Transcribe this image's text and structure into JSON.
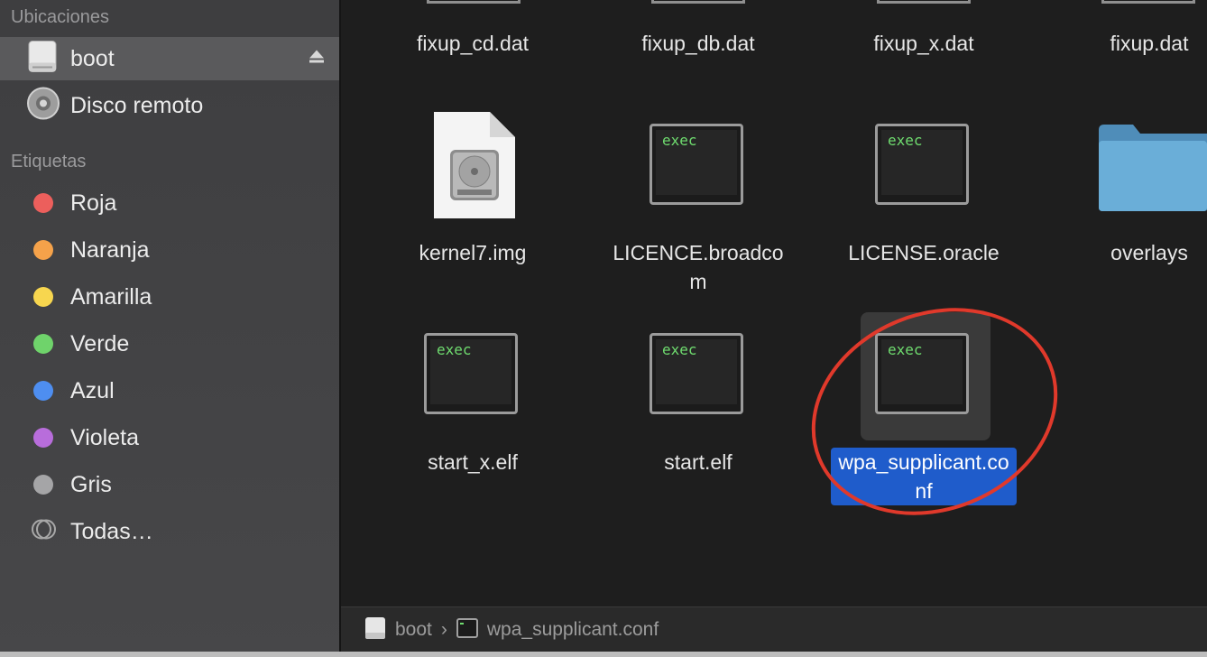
{
  "sidebar": {
    "locations_header": "Ubicaciones",
    "locations": [
      {
        "label": "boot",
        "icon": "drive-icon",
        "selected": true
      },
      {
        "label": "Disco remoto",
        "icon": "disc-icon",
        "selected": false
      }
    ],
    "tags_header": "Etiquetas",
    "tags": [
      {
        "label": "Roja",
        "color": "#ec5f5c"
      },
      {
        "label": "Naranja",
        "color": "#f5a24a"
      },
      {
        "label": "Amarilla",
        "color": "#f7d64f"
      },
      {
        "label": "Verde",
        "color": "#6fd36b"
      },
      {
        "label": "Azul",
        "color": "#4e8ef0"
      },
      {
        "label": "Violeta",
        "color": "#b86ddb"
      },
      {
        "label": "Gris",
        "color": "#a5a5a7"
      },
      {
        "label": "Todas…",
        "color": "none"
      }
    ]
  },
  "files": {
    "row1": [
      "fixup_cd.dat",
      "fixup_db.dat",
      "fixup_x.dat",
      "fixup.dat"
    ],
    "row2": [
      {
        "name": "kernel7.img",
        "icon": "disk-image-icon"
      },
      {
        "name": "LICENCE.broadcom",
        "icon": "exec-icon"
      },
      {
        "name": "LICENSE.oracle",
        "icon": "exec-icon"
      },
      {
        "name": "overlays",
        "icon": "folder-icon"
      }
    ],
    "row3": [
      {
        "name": "start_x.elf",
        "icon": "exec-icon"
      },
      {
        "name": "start.elf",
        "icon": "exec-icon"
      },
      {
        "name": "wpa_supplicant.conf",
        "icon": "exec-icon",
        "selected": true
      }
    ],
    "exec_label": "exec"
  },
  "pathbar": {
    "root": "boot",
    "separator": "›",
    "current": "wpa_supplicant.conf"
  },
  "colors": {
    "selection": "#1f5ccb",
    "annotation": "#e0392b"
  }
}
